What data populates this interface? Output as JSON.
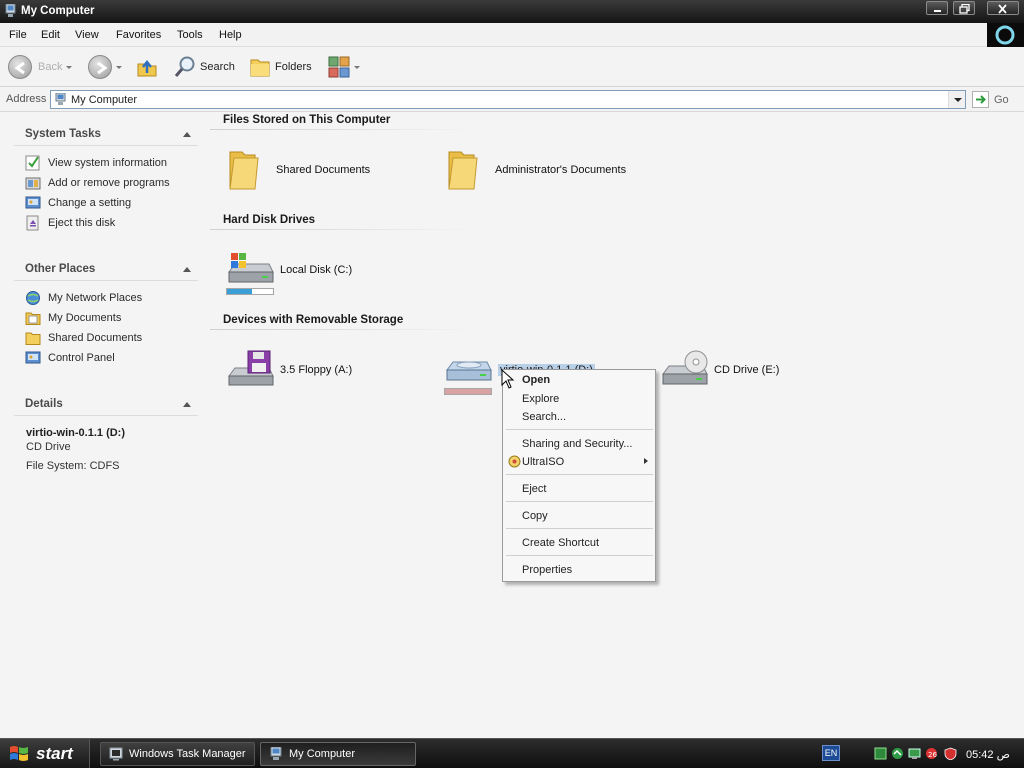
{
  "window": {
    "title": "My Computer",
    "controls": [
      "minimize",
      "maximize",
      "close"
    ]
  },
  "menubar": {
    "items": [
      "File",
      "Edit",
      "View",
      "Favorites",
      "Tools",
      "Help"
    ]
  },
  "toolbar": {
    "back_label": "Back",
    "search_label": "Search",
    "folders_label": "Folders"
  },
  "address": {
    "label": "Address",
    "value": "My Computer",
    "go_label": "Go"
  },
  "taskpane": {
    "system_tasks": {
      "title": "System Tasks",
      "items": [
        {
          "label": "View system information",
          "icon": "system-info-icon"
        },
        {
          "label": "Add or remove programs",
          "icon": "add-remove-icon"
        },
        {
          "label": "Change a setting",
          "icon": "control-panel-icon"
        },
        {
          "label": "Eject this disk",
          "icon": "eject-icon"
        }
      ]
    },
    "other_places": {
      "title": "Other Places",
      "items": [
        {
          "label": "My Network Places",
          "icon": "network-icon"
        },
        {
          "label": "My Documents",
          "icon": "documents-icon"
        },
        {
          "label": "Shared Documents",
          "icon": "folder-icon"
        },
        {
          "label": "Control Panel",
          "icon": "control-panel-icon"
        }
      ]
    },
    "details": {
      "title": "Details",
      "name": "virtio-win-0.1.1 (D:)",
      "type": "CD Drive",
      "filesystem": "File System: CDFS"
    }
  },
  "content": {
    "groups": [
      {
        "title": "Files Stored on This Computer",
        "items": [
          {
            "label": "Shared Documents",
            "icon": "folder-icon"
          },
          {
            "label": "Administrator's Documents",
            "icon": "folder-icon"
          }
        ]
      },
      {
        "title": "Hard Disk Drives",
        "items": [
          {
            "label": "Local Disk (C:)",
            "icon": "hard-disk-icon",
            "used_fraction": 0.55
          }
        ]
      },
      {
        "title": "Devices with Removable Storage",
        "items": [
          {
            "label": "3.5 Floppy (A:)",
            "icon": "floppy-icon"
          },
          {
            "label": "virtio-win-0.1.1 (D:)",
            "icon": "cd-drive-icon",
            "selected": true,
            "used_fraction": 1.0
          },
          {
            "label": "CD Drive (E:)",
            "icon": "cd-drive-icon"
          }
        ]
      }
    ]
  },
  "context_menu": {
    "items": [
      "Open",
      "Explore",
      "Search...",
      "Sharing and Security...",
      "UltraISO",
      "Eject",
      "Copy",
      "Create Shortcut",
      "Properties"
    ]
  },
  "taskbar": {
    "start_label": "start",
    "buttons": [
      "Windows Task Manager",
      "My Computer"
    ],
    "language": "EN",
    "clock": "05:42 ص"
  },
  "colors": {
    "titlebar": "#1e1e1e",
    "selection": "#b8cfe8",
    "local_disk_bar": "#3a9fd6",
    "cd_disk_bar": "#d9a3a3"
  }
}
